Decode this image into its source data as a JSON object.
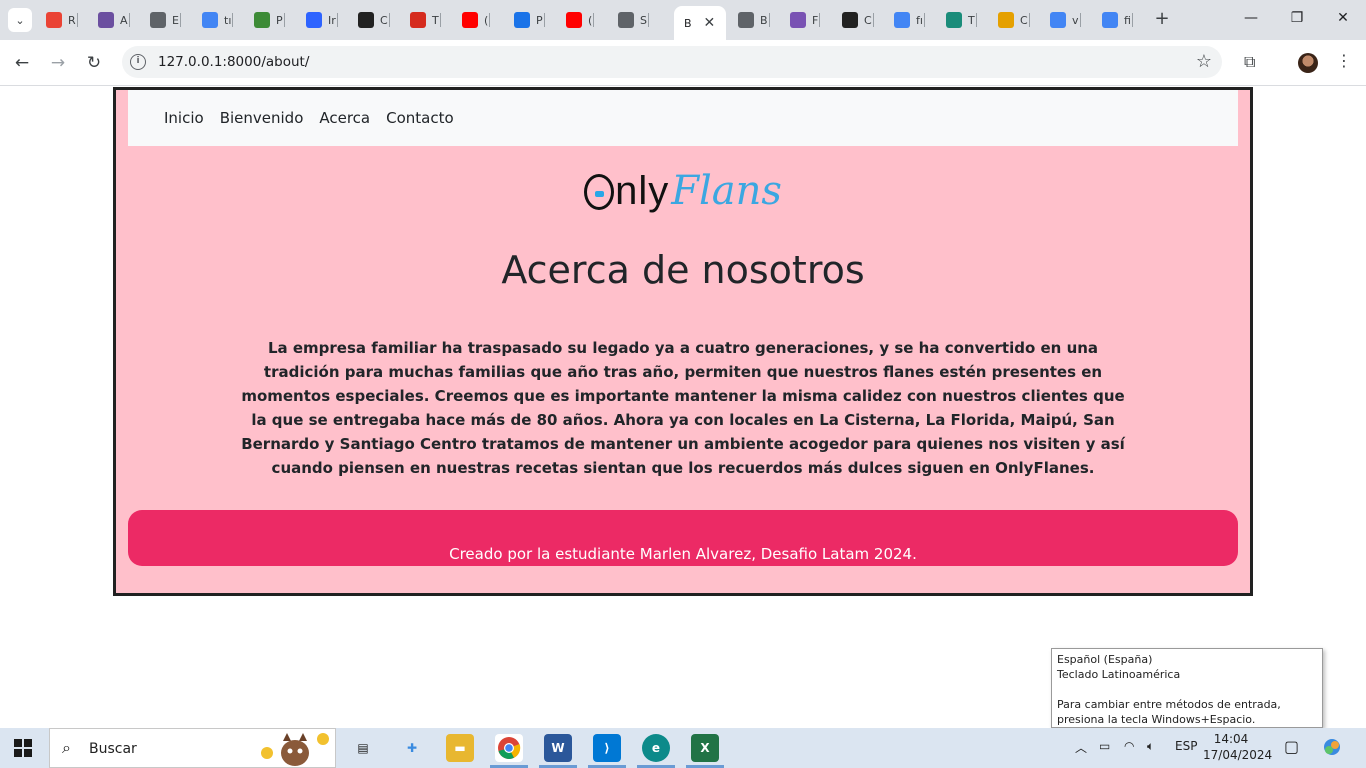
{
  "browser": {
    "tab_list_icon": "chevron-down-icon",
    "tabs": [
      {
        "letter": "R",
        "icon": "gmail-icon",
        "color": "#ea4335"
      },
      {
        "letter": "A",
        "icon": "app-icon",
        "color": "#6b4fa0"
      },
      {
        "letter": "E",
        "icon": "gear-icon",
        "color": "#5f6368"
      },
      {
        "letter": "tı",
        "icon": "google-icon",
        "color": "#4285f4"
      },
      {
        "letter": "P",
        "icon": "code-icon",
        "color": "#3d8b37"
      },
      {
        "letter": "Ir",
        "icon": "zoom-icon",
        "color": "#2d63ff"
      },
      {
        "letter": "C",
        "icon": "github-icon",
        "color": "#222222"
      },
      {
        "letter": "T",
        "icon": "flag-icon",
        "color": "#d52b1e"
      },
      {
        "letter": "(",
        "icon": "youtube-icon",
        "color": "#ff0000"
      },
      {
        "letter": "P",
        "icon": "play-icon",
        "color": "#1a73e8"
      },
      {
        "letter": "(",
        "icon": "youtube-icon",
        "color": "#ff0000"
      },
      {
        "letter": "S",
        "icon": "globe-icon",
        "color": "#5f6368"
      }
    ],
    "active_tab": {
      "letter": "B"
    },
    "tabs_right": [
      {
        "letter": "B",
        "icon": "globe-icon",
        "color": "#5f6368"
      },
      {
        "letter": "F",
        "icon": "bootstrap-icon",
        "color": "#7952b3"
      },
      {
        "letter": "C",
        "icon": "codepen-icon",
        "color": "#222222"
      },
      {
        "letter": "fı",
        "icon": "google-icon",
        "color": "#4285f4"
      },
      {
        "letter": "T",
        "icon": "openai-icon",
        "color": "#1a8c7a"
      },
      {
        "letter": "C",
        "icon": "app-icon",
        "color": "#e5a000"
      },
      {
        "letter": "v",
        "icon": "google-icon",
        "color": "#4285f4"
      },
      {
        "letter": "fi",
        "icon": "google-icon",
        "color": "#4285f4"
      }
    ],
    "url": "127.0.0.1:8000/about/"
  },
  "site": {
    "nav": [
      "Inicio",
      "Bienvenido",
      "Acerca",
      "Contacto"
    ],
    "logo_only": "nly",
    "logo_flans": "Flans",
    "title": "Acerca de nosotros",
    "about": "La empresa familiar ha traspasado su legado ya a cuatro generaciones, y se ha convertido en una tradición para muchas familias que año tras año, permiten que nuestros flanes estén presentes en momentos especiales. Creemos que es importante mantener la misma calidez con nuestros clientes que la que se entregaba hace más de 80 años. Ahora ya con locales en La Cisterna, La Florida, Maipú, San Bernardo y Santiago Centro tratamos de mantener un ambiente acogedor para quienes nos visiten y así cuando piensen en nuestras recetas sientan que los recuerdos más dulces siguen en OnlyFlanes.",
    "footer": "Creado por la estudiante Marlen Alvarez, Desafio Latam 2024.",
    "bg_color": "#ffc0cb",
    "footer_color": "#ec2a65"
  },
  "ime": {
    "line1": "Español (España)",
    "line2": "Teclado Latinoamérica",
    "line3": "Para cambiar entre métodos de entrada, presiona la tecla Windows+Espacio."
  },
  "taskbar": {
    "search_label": "Buscar",
    "apps": [
      {
        "name": "task-view-icon",
        "label": "",
        "color": "#dbe5f1"
      },
      {
        "name": "widgets-icon",
        "label": "",
        "color": "#dbe5f1"
      },
      {
        "name": "file-explorer-icon",
        "label": "",
        "color": "#e8b730"
      },
      {
        "name": "chrome-icon",
        "label": "",
        "color": "#ffffff"
      },
      {
        "name": "word-icon",
        "label": "W",
        "color": "#2b579a"
      },
      {
        "name": "vscode-icon",
        "label": "",
        "color": "#0078d4"
      },
      {
        "name": "edge-icon",
        "label": "",
        "color": "#0c8a8a"
      },
      {
        "name": "excel-icon",
        "label": "X",
        "color": "#217346"
      }
    ],
    "lang": "ESP",
    "time": "14:04",
    "date": "17/04/2024"
  }
}
